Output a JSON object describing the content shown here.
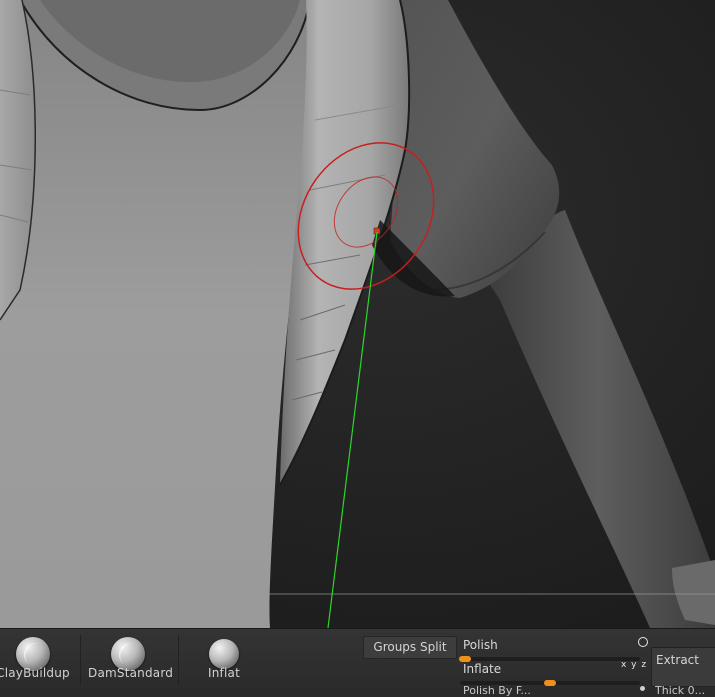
{
  "shelf": {
    "brushes": [
      {
        "label": "ClayBuildup",
        "icon": "claybuildup-brush-icon"
      },
      {
        "label": "DamStandard",
        "icon": "damstandard-brush-icon"
      },
      {
        "label": "Inflat",
        "icon": "inflat-brush-icon"
      }
    ],
    "groups_split_label": "Groups Split",
    "polish": {
      "label": "Polish",
      "value": 0.03
    },
    "inflate": {
      "label": "Inflate",
      "value": 0.5,
      "axis_label": "x y z"
    },
    "polish_by_features_label": "Polish By F...",
    "extract_label": "Extract",
    "thick_label": "Thick 0..."
  },
  "colors": {
    "slider_accent": "#e07c12",
    "brush_cursor": "#c81e1e",
    "stroke_line": "#2bd62b"
  }
}
